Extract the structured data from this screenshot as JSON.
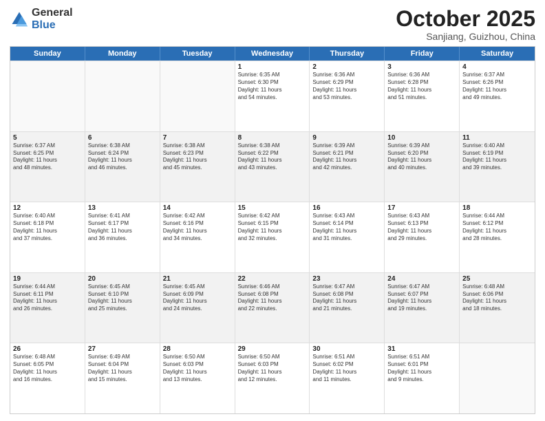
{
  "header": {
    "logo_general": "General",
    "logo_blue": "Blue",
    "month_title": "October 2025",
    "subtitle": "Sanjiang, Guizhou, China"
  },
  "weekdays": [
    "Sunday",
    "Monday",
    "Tuesday",
    "Wednesday",
    "Thursday",
    "Friday",
    "Saturday"
  ],
  "rows": [
    [
      {
        "day": "",
        "info": ""
      },
      {
        "day": "",
        "info": ""
      },
      {
        "day": "",
        "info": ""
      },
      {
        "day": "1",
        "info": "Sunrise: 6:35 AM\nSunset: 6:30 PM\nDaylight: 11 hours\nand 54 minutes."
      },
      {
        "day": "2",
        "info": "Sunrise: 6:36 AM\nSunset: 6:29 PM\nDaylight: 11 hours\nand 53 minutes."
      },
      {
        "day": "3",
        "info": "Sunrise: 6:36 AM\nSunset: 6:28 PM\nDaylight: 11 hours\nand 51 minutes."
      },
      {
        "day": "4",
        "info": "Sunrise: 6:37 AM\nSunset: 6:26 PM\nDaylight: 11 hours\nand 49 minutes."
      }
    ],
    [
      {
        "day": "5",
        "info": "Sunrise: 6:37 AM\nSunset: 6:25 PM\nDaylight: 11 hours\nand 48 minutes."
      },
      {
        "day": "6",
        "info": "Sunrise: 6:38 AM\nSunset: 6:24 PM\nDaylight: 11 hours\nand 46 minutes."
      },
      {
        "day": "7",
        "info": "Sunrise: 6:38 AM\nSunset: 6:23 PM\nDaylight: 11 hours\nand 45 minutes."
      },
      {
        "day": "8",
        "info": "Sunrise: 6:38 AM\nSunset: 6:22 PM\nDaylight: 11 hours\nand 43 minutes."
      },
      {
        "day": "9",
        "info": "Sunrise: 6:39 AM\nSunset: 6:21 PM\nDaylight: 11 hours\nand 42 minutes."
      },
      {
        "day": "10",
        "info": "Sunrise: 6:39 AM\nSunset: 6:20 PM\nDaylight: 11 hours\nand 40 minutes."
      },
      {
        "day": "11",
        "info": "Sunrise: 6:40 AM\nSunset: 6:19 PM\nDaylight: 11 hours\nand 39 minutes."
      }
    ],
    [
      {
        "day": "12",
        "info": "Sunrise: 6:40 AM\nSunset: 6:18 PM\nDaylight: 11 hours\nand 37 minutes."
      },
      {
        "day": "13",
        "info": "Sunrise: 6:41 AM\nSunset: 6:17 PM\nDaylight: 11 hours\nand 36 minutes."
      },
      {
        "day": "14",
        "info": "Sunrise: 6:42 AM\nSunset: 6:16 PM\nDaylight: 11 hours\nand 34 minutes."
      },
      {
        "day": "15",
        "info": "Sunrise: 6:42 AM\nSunset: 6:15 PM\nDaylight: 11 hours\nand 32 minutes."
      },
      {
        "day": "16",
        "info": "Sunrise: 6:43 AM\nSunset: 6:14 PM\nDaylight: 11 hours\nand 31 minutes."
      },
      {
        "day": "17",
        "info": "Sunrise: 6:43 AM\nSunset: 6:13 PM\nDaylight: 11 hours\nand 29 minutes."
      },
      {
        "day": "18",
        "info": "Sunrise: 6:44 AM\nSunset: 6:12 PM\nDaylight: 11 hours\nand 28 minutes."
      }
    ],
    [
      {
        "day": "19",
        "info": "Sunrise: 6:44 AM\nSunset: 6:11 PM\nDaylight: 11 hours\nand 26 minutes."
      },
      {
        "day": "20",
        "info": "Sunrise: 6:45 AM\nSunset: 6:10 PM\nDaylight: 11 hours\nand 25 minutes."
      },
      {
        "day": "21",
        "info": "Sunrise: 6:45 AM\nSunset: 6:09 PM\nDaylight: 11 hours\nand 24 minutes."
      },
      {
        "day": "22",
        "info": "Sunrise: 6:46 AM\nSunset: 6:08 PM\nDaylight: 11 hours\nand 22 minutes."
      },
      {
        "day": "23",
        "info": "Sunrise: 6:47 AM\nSunset: 6:08 PM\nDaylight: 11 hours\nand 21 minutes."
      },
      {
        "day": "24",
        "info": "Sunrise: 6:47 AM\nSunset: 6:07 PM\nDaylight: 11 hours\nand 19 minutes."
      },
      {
        "day": "25",
        "info": "Sunrise: 6:48 AM\nSunset: 6:06 PM\nDaylight: 11 hours\nand 18 minutes."
      }
    ],
    [
      {
        "day": "26",
        "info": "Sunrise: 6:48 AM\nSunset: 6:05 PM\nDaylight: 11 hours\nand 16 minutes."
      },
      {
        "day": "27",
        "info": "Sunrise: 6:49 AM\nSunset: 6:04 PM\nDaylight: 11 hours\nand 15 minutes."
      },
      {
        "day": "28",
        "info": "Sunrise: 6:50 AM\nSunset: 6:03 PM\nDaylight: 11 hours\nand 13 minutes."
      },
      {
        "day": "29",
        "info": "Sunrise: 6:50 AM\nSunset: 6:03 PM\nDaylight: 11 hours\nand 12 minutes."
      },
      {
        "day": "30",
        "info": "Sunrise: 6:51 AM\nSunset: 6:02 PM\nDaylight: 11 hours\nand 11 minutes."
      },
      {
        "day": "31",
        "info": "Sunrise: 6:51 AM\nSunset: 6:01 PM\nDaylight: 11 hours\nand 9 minutes."
      },
      {
        "day": "",
        "info": ""
      }
    ]
  ]
}
